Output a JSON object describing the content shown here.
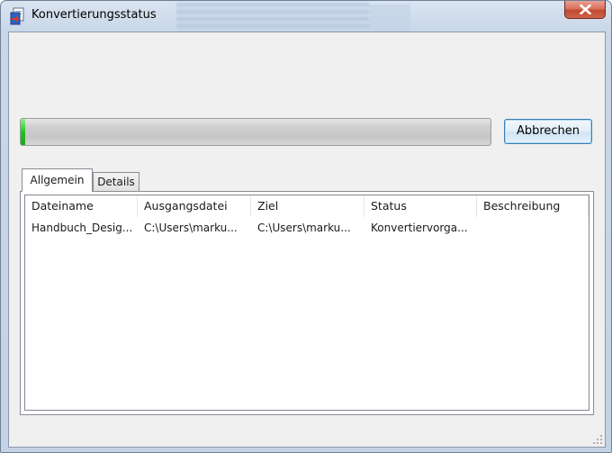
{
  "window": {
    "title": "Konvertierungsstatus"
  },
  "progress": {
    "fraction": 0.01
  },
  "buttons": {
    "cancel_label": "Abbrechen"
  },
  "tabs": [
    {
      "label": "Allgemein",
      "active": true
    },
    {
      "label": "Details",
      "active": false
    }
  ],
  "table": {
    "columns": [
      "Dateiname",
      "Ausgangsdatei",
      "Ziel",
      "Status",
      "Beschreibung"
    ],
    "rows": [
      [
        "Handbuch_Desig...",
        "C:\\Users\\marku...",
        "C:\\Users\\marku...",
        "Konvertiervorga...",
        ""
      ]
    ]
  },
  "colors": {
    "progress_green": "#22c322",
    "close_red": "#c04a32",
    "button_border": "#3c7fb1"
  },
  "icons": {
    "app": "document-convert-icon",
    "close": "close-icon"
  }
}
